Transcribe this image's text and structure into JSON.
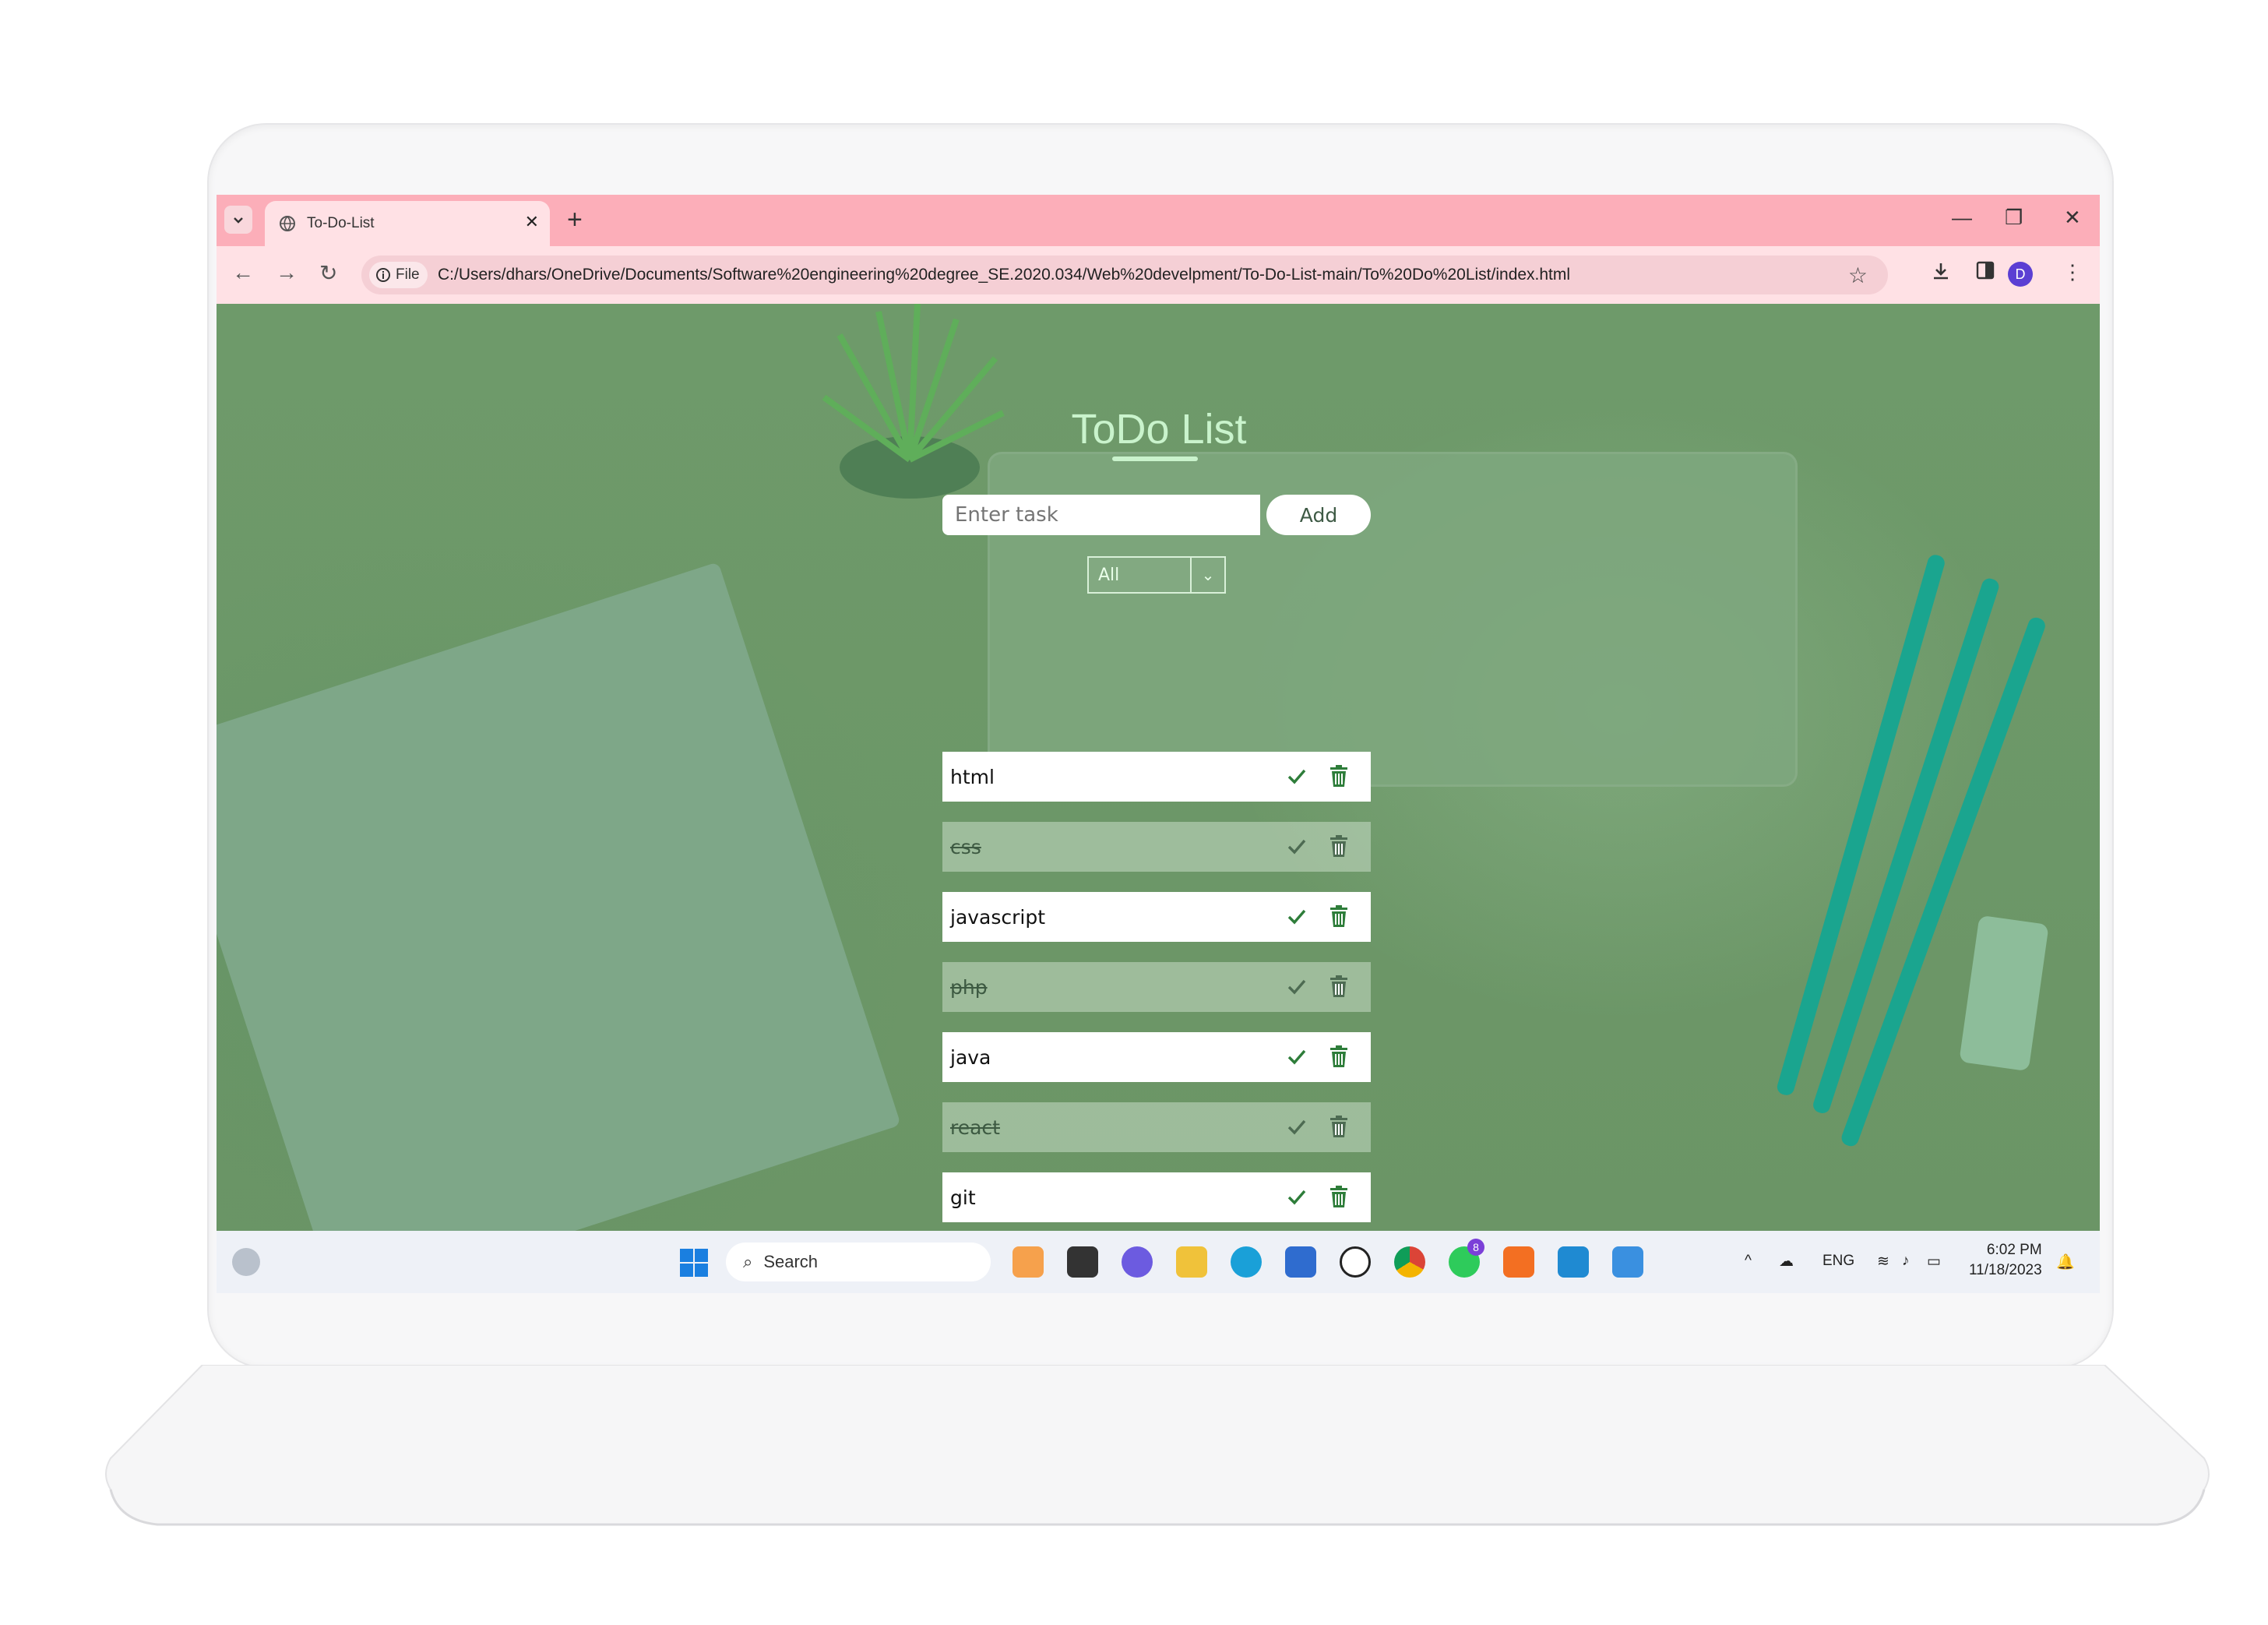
{
  "browser": {
    "tab_title": "To-Do-List",
    "new_tab_label": "+",
    "file_chip": "File",
    "url": "C:/Users/dhars/OneDrive/Documents/Software%20engineering%20degree_SE.2020.034/Web%20develpment/To-Do-List-main/To%20Do%20List/index.html",
    "profile_initial": "D",
    "accent_color": "#fcaeb9"
  },
  "app": {
    "title": "ToDo List",
    "input_placeholder": "Enter task",
    "add_label": "Add",
    "filter_selected": "All",
    "todos": [
      {
        "text": "html",
        "done": false
      },
      {
        "text": "css",
        "done": true
      },
      {
        "text": "javascript",
        "done": false
      },
      {
        "text": "php",
        "done": true
      },
      {
        "text": "java",
        "done": false
      },
      {
        "text": "react",
        "done": true
      },
      {
        "text": "git",
        "done": false
      }
    ]
  },
  "taskbar": {
    "search_label": "Search",
    "language": "ENG",
    "time": "6:02 PM",
    "date": "11/18/2023",
    "whatsapp_badge": "8"
  }
}
